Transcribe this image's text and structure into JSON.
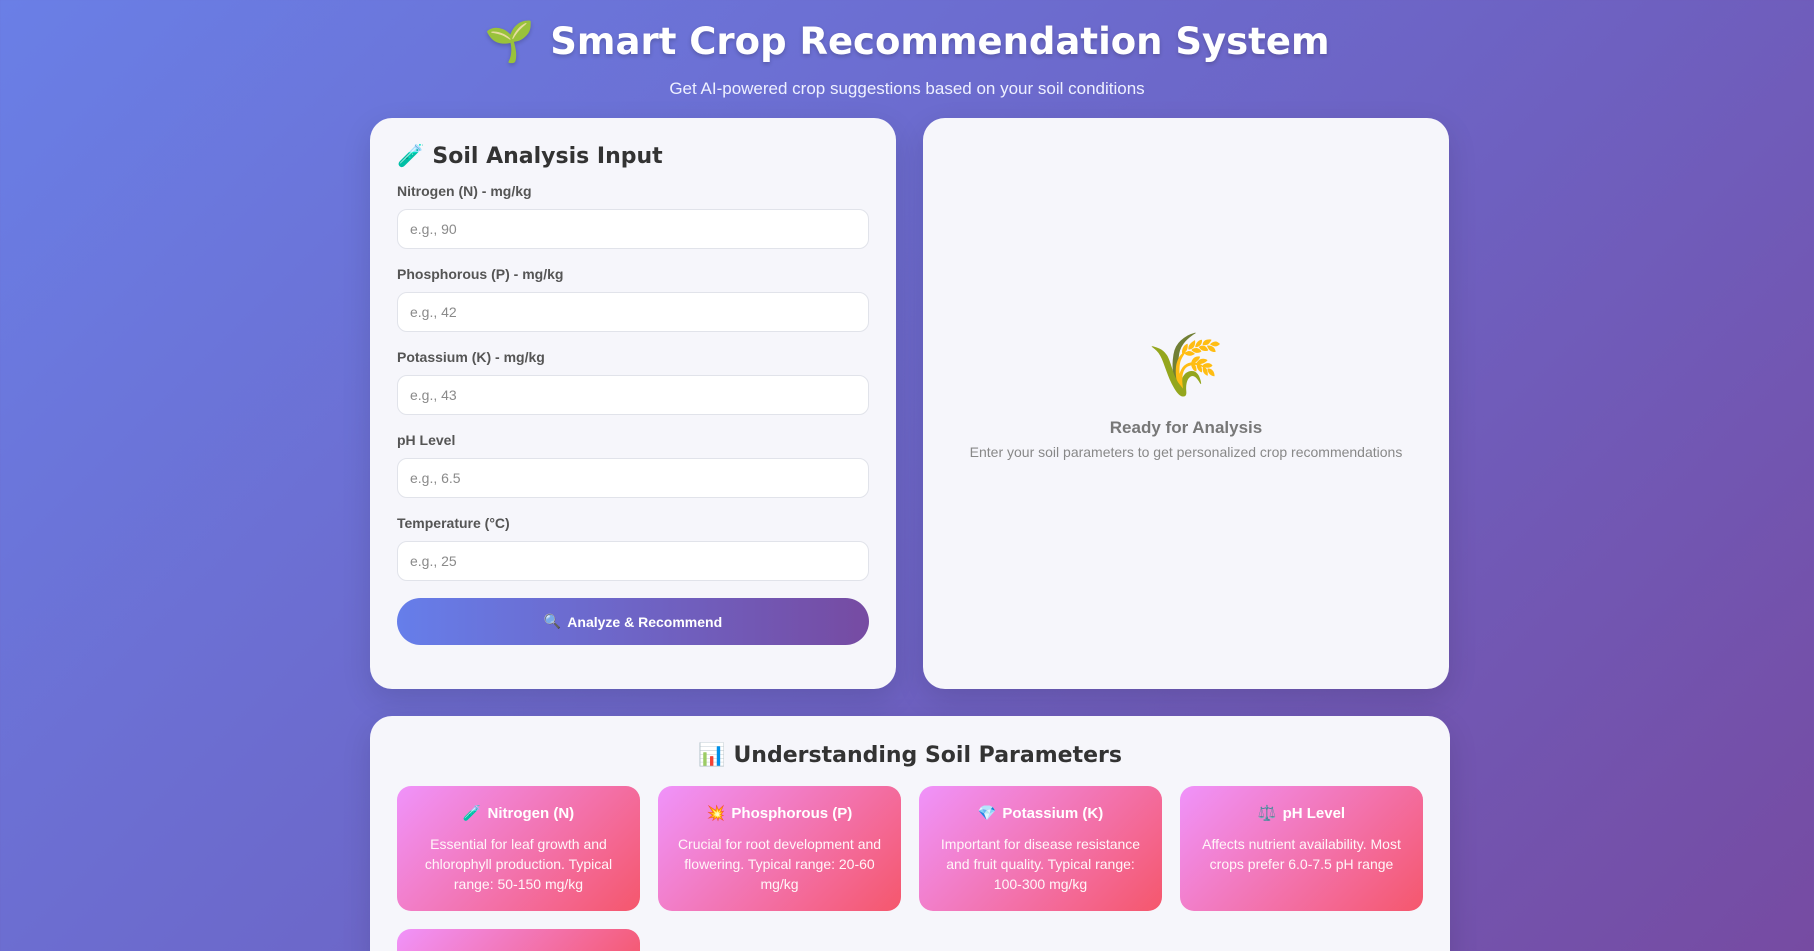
{
  "header": {
    "icon": "🌱",
    "title": "Smart Crop Recommendation System",
    "subtitle": "Get AI-powered crop suggestions based on your soil conditions"
  },
  "input_card": {
    "icon": "🧪",
    "title": "Soil Analysis Input",
    "fields": [
      {
        "label": "Nitrogen (N) - mg/kg",
        "placeholder": "e.g., 90",
        "value": ""
      },
      {
        "label": "Phosphorous (P) - mg/kg",
        "placeholder": "e.g., 42",
        "value": ""
      },
      {
        "label": "Potassium (K) - mg/kg",
        "placeholder": "e.g., 43",
        "value": ""
      },
      {
        "label": "pH Level",
        "placeholder": "e.g., 6.5",
        "value": ""
      },
      {
        "label": "Temperature (°C)",
        "placeholder": "e.g., 25",
        "value": ""
      }
    ],
    "button_icon": "🔍",
    "button_label": "Analyze & Recommend"
  },
  "result_card": {
    "icon": "🌾",
    "title": "Ready for Analysis",
    "description": "Enter your soil parameters to get personalized crop recommendations"
  },
  "info_section": {
    "icon": "📊",
    "title": "Understanding Soil Parameters",
    "cards": [
      {
        "icon": "🧪",
        "title": "Nitrogen (N)",
        "description": "Essential for leaf growth and chlorophyll production. Typical range: 50-150 mg/kg"
      },
      {
        "icon": "💥",
        "title": "Phosphorous (P)",
        "description": "Crucial for root development and flowering. Typical range: 20-60 mg/kg"
      },
      {
        "icon": "💎",
        "title": "Potassium (K)",
        "description": "Important for disease resistance and fruit quality. Typical range: 100-300 mg/kg"
      },
      {
        "icon": "⚖️",
        "title": "pH Level",
        "description": "Affects nutrient availability. Most crops prefer 6.0-7.5 pH range"
      }
    ]
  },
  "colors": {
    "bg_start": "#667eea",
    "bg_end": "#764ba2",
    "card_gradient_start": "#f093fb",
    "card_gradient_end": "#f5576c"
  }
}
